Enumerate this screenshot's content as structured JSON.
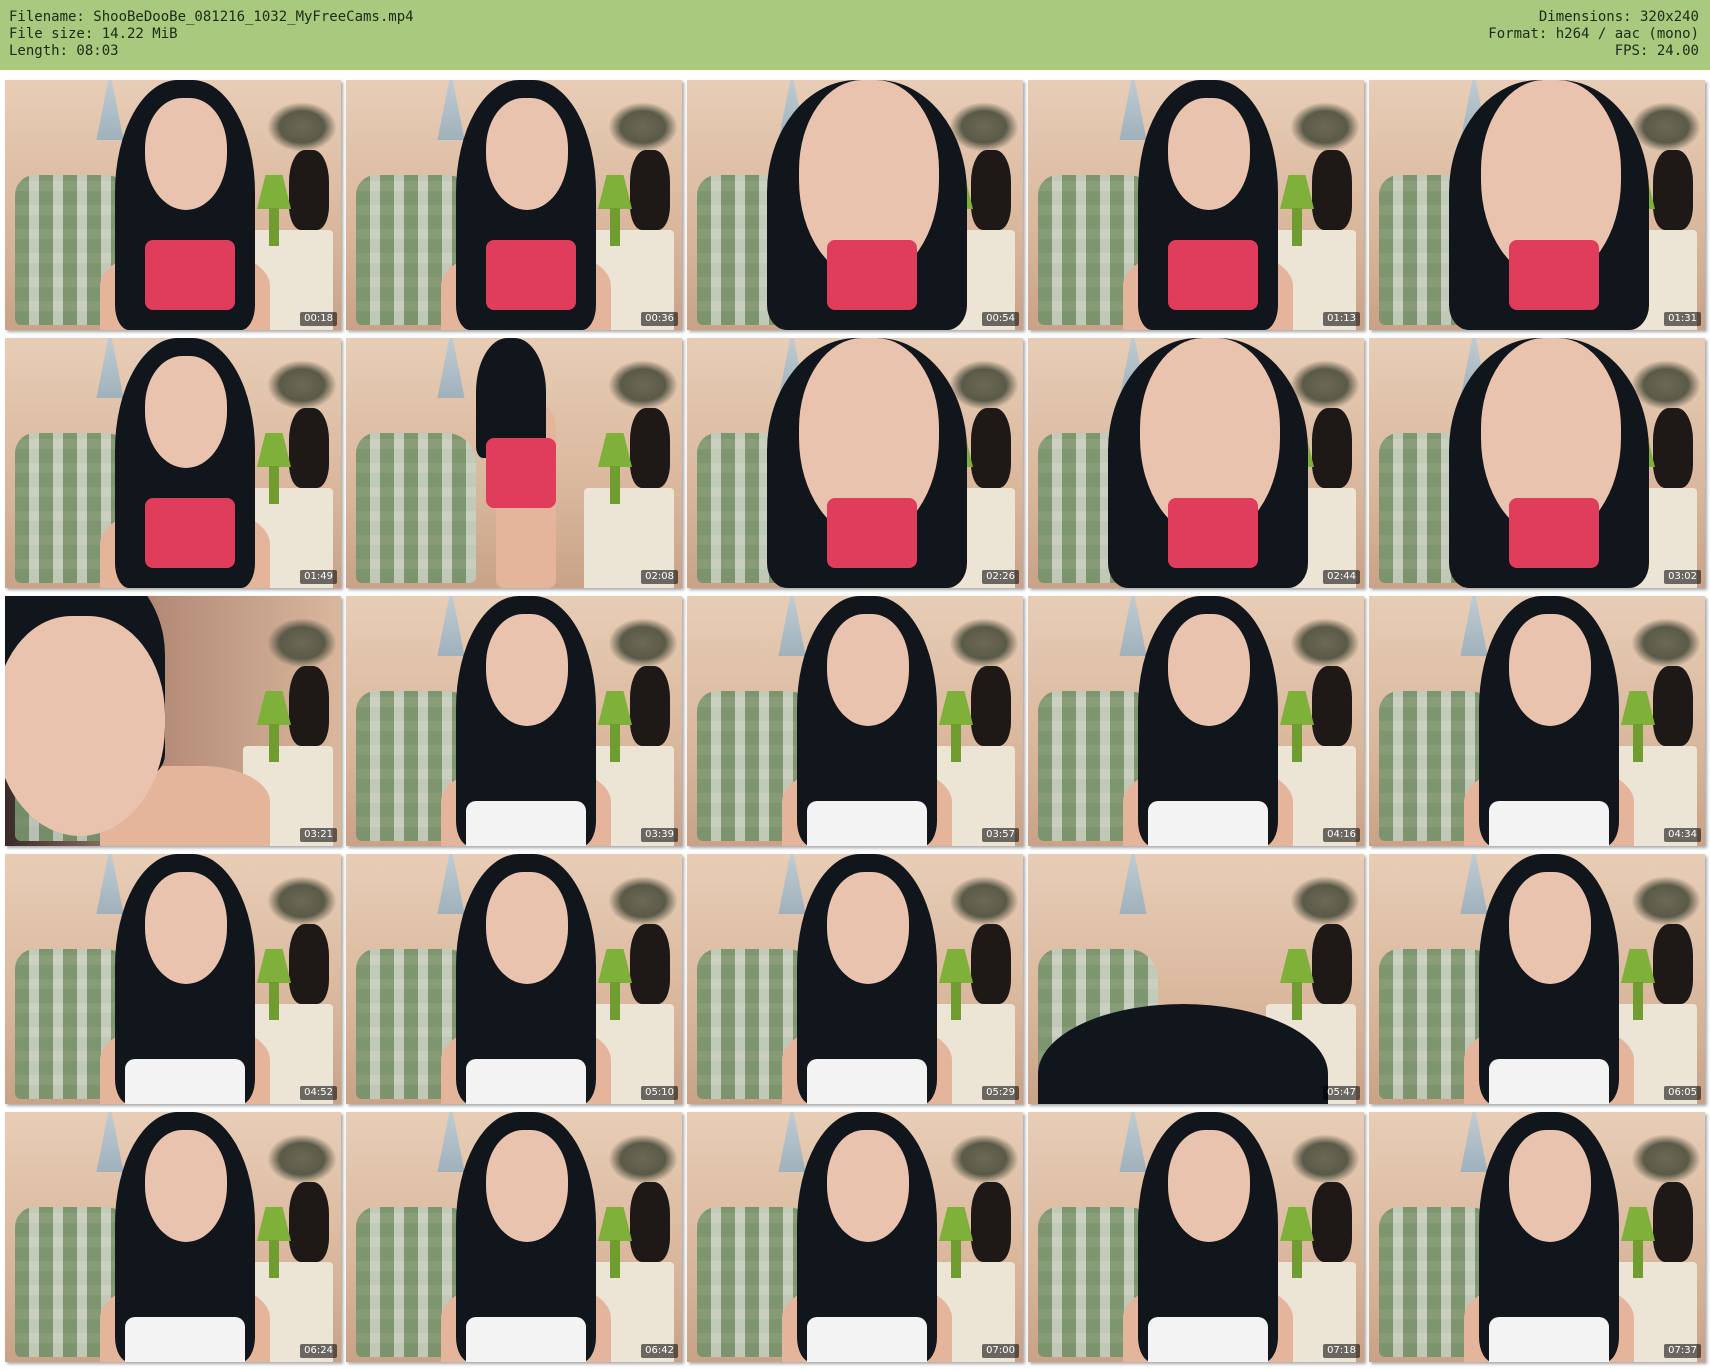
{
  "header": {
    "filename_line": "Filename: ShooBeDooBe_081216_1032_MyFreeCams.mp4",
    "filesize_line": "File size: 14.22 MiB",
    "length_line": "Length: 08:03",
    "dimensions_line": "Dimensions: 320x240",
    "format_line": "Format: h264 / aac (mono)",
    "fps_line": "FPS: 24.00"
  },
  "colors": {
    "header_bg": "#a8c97e",
    "page_bg": "#ffffff"
  },
  "frames": [
    {
      "time": "00:18",
      "scene": "face-leaning"
    },
    {
      "time": "00:36",
      "scene": "face-leaning"
    },
    {
      "time": "00:54",
      "scene": "face-large"
    },
    {
      "time": "01:13",
      "scene": "face-leaning"
    },
    {
      "time": "01:31",
      "scene": "face-large"
    },
    {
      "time": "01:49",
      "scene": "face-leaning"
    },
    {
      "time": "02:08",
      "scene": "standing"
    },
    {
      "time": "02:26",
      "scene": "face-large"
    },
    {
      "time": "02:44",
      "scene": "face-large"
    },
    {
      "time": "03:02",
      "scene": "face-large"
    },
    {
      "time": "03:21",
      "scene": "closeup"
    },
    {
      "time": "03:39",
      "scene": "seated"
    },
    {
      "time": "03:57",
      "scene": "seated"
    },
    {
      "time": "04:16",
      "scene": "seated"
    },
    {
      "time": "04:34",
      "scene": "seated"
    },
    {
      "time": "04:52",
      "scene": "seated"
    },
    {
      "time": "05:10",
      "scene": "seated"
    },
    {
      "time": "05:29",
      "scene": "seated"
    },
    {
      "time": "05:47",
      "scene": "hair-only"
    },
    {
      "time": "06:05",
      "scene": "seated"
    },
    {
      "time": "06:24",
      "scene": "seated"
    },
    {
      "time": "06:42",
      "scene": "seated"
    },
    {
      "time": "07:00",
      "scene": "seated"
    },
    {
      "time": "07:18",
      "scene": "seated"
    },
    {
      "time": "07:37",
      "scene": "seated"
    }
  ]
}
